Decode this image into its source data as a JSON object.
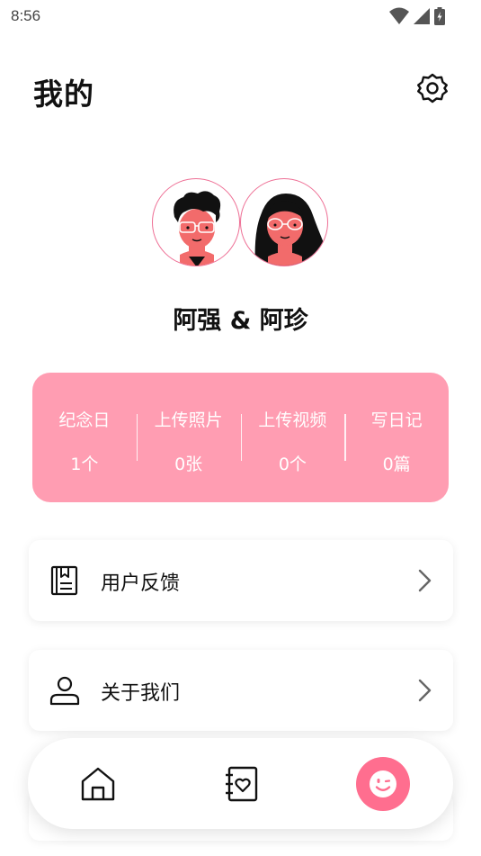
{
  "status_bar": {
    "time": "8:56",
    "icons": [
      "wifi-icon",
      "signal-icon",
      "battery-charging-icon"
    ]
  },
  "header": {
    "title": "我的",
    "settings_icon": "gear-icon"
  },
  "profile": {
    "avatars": [
      "male-avatar",
      "female-avatar"
    ],
    "names": "阿强 & 阿珍"
  },
  "stats": [
    {
      "label": "纪念日",
      "value": "1个"
    },
    {
      "label": "上传照片",
      "value": "0张"
    },
    {
      "label": "上传视频",
      "value": "0个"
    },
    {
      "label": "写日记",
      "value": "0篇"
    }
  ],
  "menu": [
    {
      "label": "用户反馈",
      "icon": "feedback-book-icon"
    },
    {
      "label": "关于我们",
      "icon": "person-icon"
    }
  ],
  "bottom_nav": {
    "items": [
      "home-icon",
      "diary-heart-icon",
      "smile-face-icon"
    ],
    "active": "smile-face-icon"
  },
  "colors": {
    "accent": "#ff6e8f",
    "stats_card": "#ff9db2",
    "avatar_border": "#ee6f95"
  }
}
